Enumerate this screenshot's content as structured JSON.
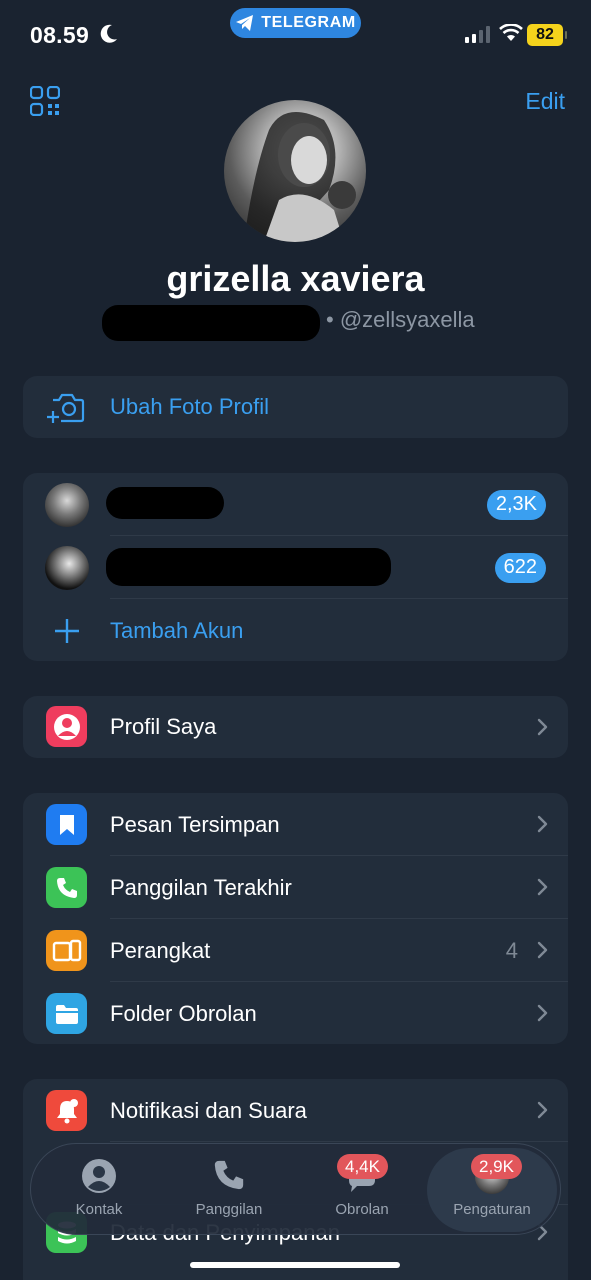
{
  "status_bar": {
    "time": "08.59",
    "app_pill": "TELEGRAM",
    "battery": "82"
  },
  "header": {
    "edit_label": "Edit"
  },
  "profile": {
    "name": "grizella xaviera",
    "username": "• @zellsyaxella"
  },
  "change_photo": {
    "label": "Ubah Foto Profil"
  },
  "accounts": {
    "items": [
      {
        "badge": "2,3K"
      },
      {
        "badge": "622"
      }
    ],
    "add_label": "Tambah Akun"
  },
  "my_profile": {
    "label": "Profil Saya"
  },
  "menu1": {
    "items": [
      {
        "label": "Pesan Tersimpan",
        "icon": "bookmark-icon",
        "color": "#1f7cf1"
      },
      {
        "label": "Panggilan Terakhir",
        "icon": "phone-icon",
        "color": "#3cc357"
      },
      {
        "label": "Perangkat",
        "icon": "devices-icon",
        "color": "#f0941b",
        "count": "4"
      },
      {
        "label": "Folder Obrolan",
        "icon": "folder-icon",
        "color": "#2fa5e3"
      }
    ]
  },
  "menu2": {
    "items": [
      {
        "label": "Notifikasi dan Suara",
        "icon": "bell-icon",
        "color": "#ef4a3c"
      },
      {
        "label": "Data dan Penyimpanan",
        "icon": "database-icon",
        "color": "#3cc357"
      }
    ]
  },
  "tabbar": {
    "tabs": [
      {
        "label": "Kontak"
      },
      {
        "label": "Panggilan"
      },
      {
        "label": "Obrolan",
        "badge": "4,4K"
      },
      {
        "label": "Pengaturan",
        "badge": "2,9K"
      }
    ]
  },
  "colors": {
    "background": "#1a2330",
    "card": "#222d3b",
    "accent": "#3a9ff0",
    "badge_red": "#e2565b"
  }
}
